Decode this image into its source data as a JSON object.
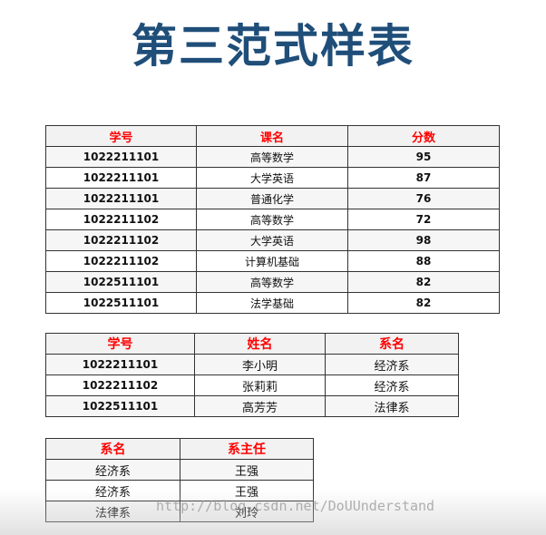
{
  "title": "第三范式样表",
  "table_scores": {
    "headers": [
      "学号",
      "课名",
      "分数"
    ],
    "rows": [
      [
        "1022211101",
        "高等数学",
        "95"
      ],
      [
        "1022211101",
        "大学英语",
        "87"
      ],
      [
        "1022211101",
        "普通化学",
        "76"
      ],
      [
        "1022211102",
        "高等数学",
        "72"
      ],
      [
        "1022211102",
        "大学英语",
        "98"
      ],
      [
        "1022211102",
        "计算机基础",
        "88"
      ],
      [
        "1022511101",
        "高等数学",
        "82"
      ],
      [
        "1022511101",
        "法学基础",
        "82"
      ]
    ]
  },
  "table_students": {
    "headers": [
      "学号",
      "姓名",
      "系名"
    ],
    "rows": [
      [
        "1022211101",
        "李小明",
        "经济系"
      ],
      [
        "1022211102",
        "张莉莉",
        "经济系"
      ],
      [
        "1022511101",
        "高芳芳",
        "法律系"
      ]
    ]
  },
  "table_departments": {
    "headers": [
      "系名",
      "系主任"
    ],
    "rows": [
      [
        "经济系",
        "王强"
      ],
      [
        "经济系",
        "王强"
      ],
      [
        "法律系",
        "刘玲"
      ]
    ]
  },
  "watermark": "http://blog.csdn.net/DoUUnderstand",
  "colors": {
    "title": "#1f4e79",
    "header_text": "#ff0000"
  }
}
